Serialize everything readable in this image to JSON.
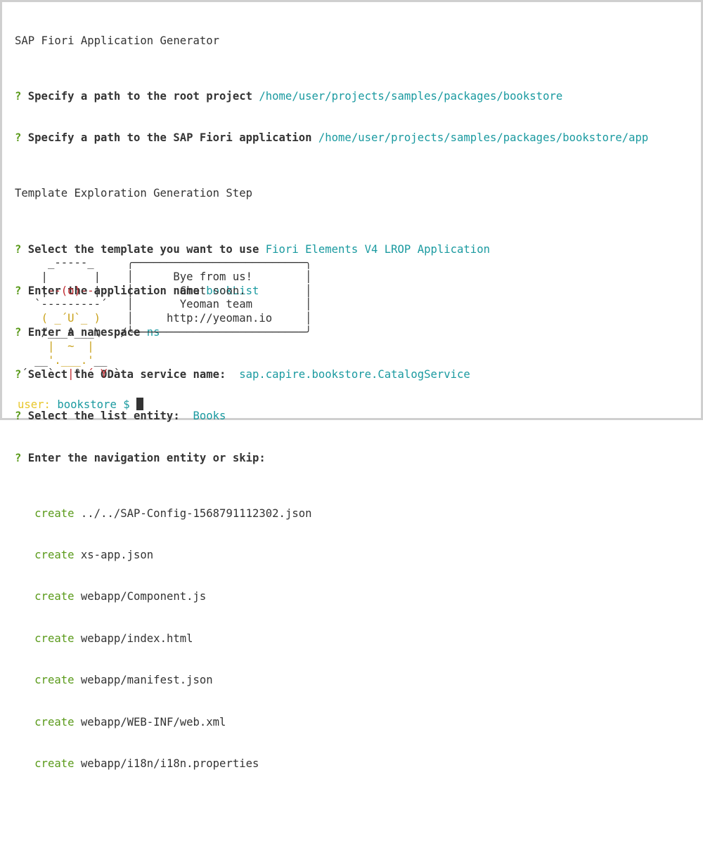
{
  "terminal": {
    "title_line": "SAP Fiori Application Generator",
    "prompts": [
      {
        "q": "?",
        "label": "Specify a path to the root project",
        "answer": "/home/user/projects/samples/packages/bookstore"
      },
      {
        "q": "?",
        "label": "Specify a path to the SAP Fiori application",
        "answer": "/home/user/projects/samples/packages/bookstore/app"
      }
    ],
    "step_line": "Template Exploration Generation Step",
    "prompts2": [
      {
        "q": "?",
        "label": "Select the template you want to use",
        "answer": "Fiori Elements V4 LROP Application"
      },
      {
        "q": "?",
        "label": "Enter the application name",
        "answer": "bookList"
      },
      {
        "q": "?",
        "label": "Enter a namespace",
        "answer": "ns"
      },
      {
        "q": "?",
        "label": "Select the OData service name: ",
        "answer": "sap.capire.bookstore.CatalogService"
      },
      {
        "q": "?",
        "label": "Select the list entity: ",
        "answer": "Books"
      },
      {
        "q": "?",
        "label": "Enter the navigation entity or skip:",
        "answer": ""
      }
    ],
    "create_word": "create",
    "created_files": [
      "../../SAP-Config-1568791112302.json",
      "xs-app.json",
      "webapp/Component.js",
      "webapp/index.html",
      "webapp/manifest.json",
      "webapp/WEB-INF/web.xml",
      "webapp/i18n/i18n.properties"
    ],
    "yeoman_bubble": [
      "Bye from us!",
      "Chat soon.",
      "Yeoman team",
      "http://yeoman.io"
    ],
    "shell_prompt": {
      "user": "user:",
      "dir": "bookstore",
      "symbol": "$"
    }
  }
}
